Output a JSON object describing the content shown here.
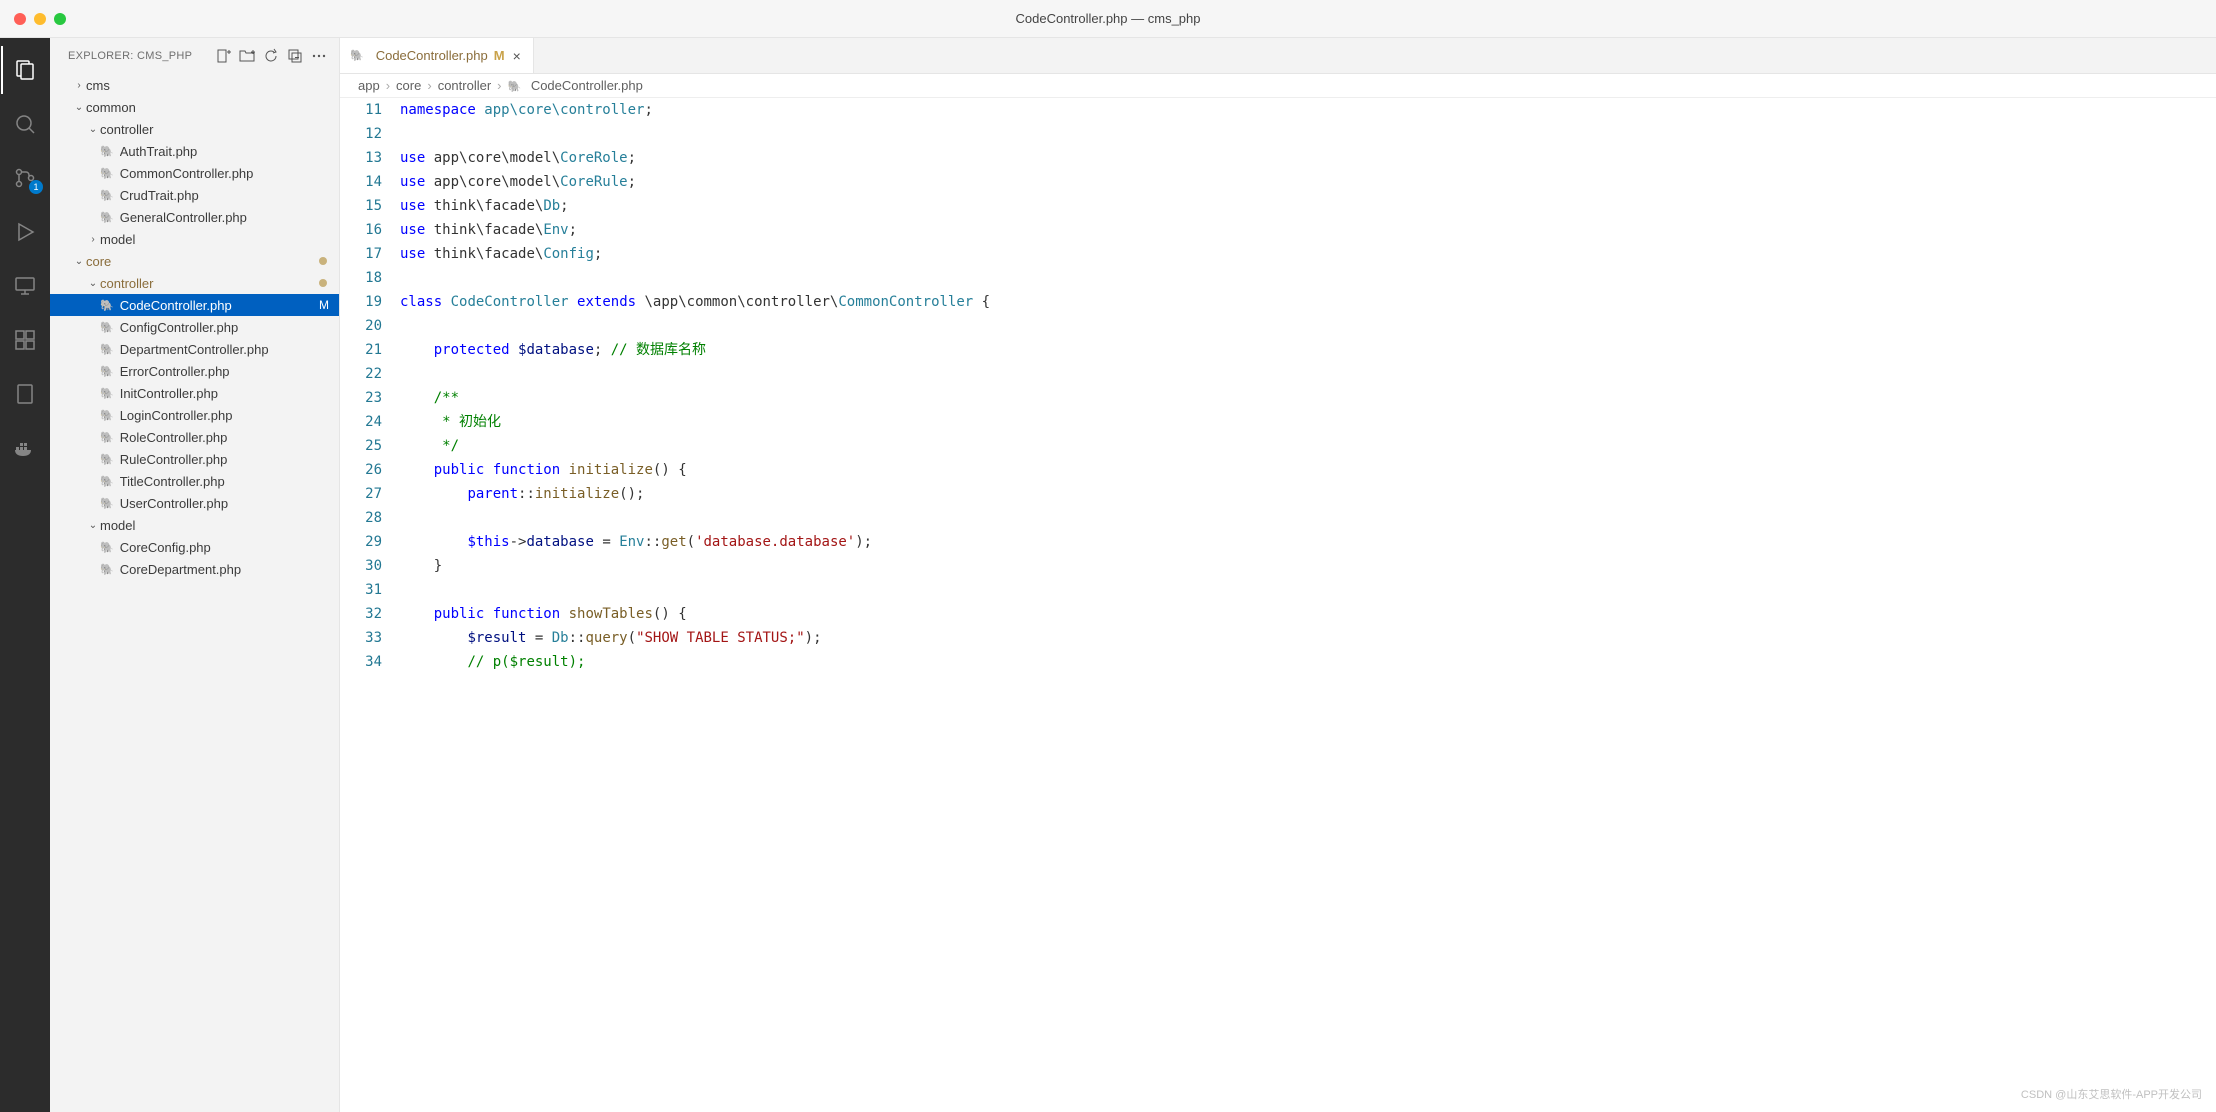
{
  "window": {
    "title": "CodeController.php — cms_php"
  },
  "activitybar": {
    "scm_badge": "1"
  },
  "sidebar": {
    "header": "EXPLORER: CMS_PHP",
    "tree": [
      {
        "depth": 1,
        "kind": "folder",
        "open": false,
        "label": "cms"
      },
      {
        "depth": 1,
        "kind": "folder",
        "open": true,
        "label": "common"
      },
      {
        "depth": 2,
        "kind": "folder",
        "open": true,
        "label": "controller"
      },
      {
        "depth": 3,
        "kind": "file",
        "icon": "php",
        "label": "AuthTrait.php"
      },
      {
        "depth": 3,
        "kind": "file",
        "icon": "php",
        "label": "CommonController.php"
      },
      {
        "depth": 3,
        "kind": "file",
        "icon": "php",
        "label": "CrudTrait.php"
      },
      {
        "depth": 3,
        "kind": "file",
        "icon": "php",
        "label": "GeneralController.php"
      },
      {
        "depth": 2,
        "kind": "folder",
        "open": false,
        "label": "model"
      },
      {
        "depth": 1,
        "kind": "folder",
        "open": true,
        "label": "core",
        "modified": true,
        "modDot": true
      },
      {
        "depth": 2,
        "kind": "folder",
        "open": true,
        "label": "controller",
        "modified": true,
        "modDot": true
      },
      {
        "depth": 3,
        "kind": "file",
        "icon": "php",
        "label": "CodeController.php",
        "selected": true,
        "modified": true,
        "mflag": "M"
      },
      {
        "depth": 3,
        "kind": "file",
        "icon": "php",
        "label": "ConfigController.php"
      },
      {
        "depth": 3,
        "kind": "file",
        "icon": "php",
        "label": "DepartmentController.php"
      },
      {
        "depth": 3,
        "kind": "file",
        "icon": "php",
        "label": "ErrorController.php"
      },
      {
        "depth": 3,
        "kind": "file",
        "icon": "php",
        "label": "InitController.php"
      },
      {
        "depth": 3,
        "kind": "file",
        "icon": "php",
        "label": "LoginController.php"
      },
      {
        "depth": 3,
        "kind": "file",
        "icon": "php",
        "label": "RoleController.php"
      },
      {
        "depth": 3,
        "kind": "file",
        "icon": "php",
        "label": "RuleController.php"
      },
      {
        "depth": 3,
        "kind": "file",
        "icon": "php",
        "label": "TitleController.php"
      },
      {
        "depth": 3,
        "kind": "file",
        "icon": "php",
        "label": "UserController.php"
      },
      {
        "depth": 2,
        "kind": "folder",
        "open": true,
        "label": "model"
      },
      {
        "depth": 3,
        "kind": "file",
        "icon": "php",
        "label": "CoreConfig.php"
      },
      {
        "depth": 3,
        "kind": "file",
        "icon": "php",
        "label": "CoreDepartment.php"
      }
    ]
  },
  "tab": {
    "icon": "php",
    "name": "CodeController.php",
    "mflag": "M"
  },
  "breadcrumbs": [
    "app",
    "core",
    "controller",
    "CodeController.php"
  ],
  "code": {
    "start": 11,
    "lines": [
      [
        {
          "t": "namespace",
          "c": "kw"
        },
        {
          "t": " "
        },
        {
          "t": "app\\core\\controller",
          "c": "ns"
        },
        {
          "t": ";"
        }
      ],
      [],
      [
        {
          "t": "use",
          "c": "kw"
        },
        {
          "t": " app\\core\\model\\"
        },
        {
          "t": "CoreRole",
          "c": "cls"
        },
        {
          "t": ";"
        }
      ],
      [
        {
          "t": "use",
          "c": "kw"
        },
        {
          "t": " app\\core\\model\\"
        },
        {
          "t": "CoreRule",
          "c": "cls"
        },
        {
          "t": ";"
        }
      ],
      [
        {
          "t": "use",
          "c": "kw"
        },
        {
          "t": " think\\facade\\"
        },
        {
          "t": "Db",
          "c": "cls"
        },
        {
          "t": ";"
        }
      ],
      [
        {
          "t": "use",
          "c": "kw"
        },
        {
          "t": " think\\facade\\"
        },
        {
          "t": "Env",
          "c": "cls"
        },
        {
          "t": ";"
        }
      ],
      [
        {
          "t": "use",
          "c": "kw"
        },
        {
          "t": " think\\facade\\"
        },
        {
          "t": "Config",
          "c": "cls"
        },
        {
          "t": ";"
        }
      ],
      [],
      [
        {
          "t": "class",
          "c": "kw"
        },
        {
          "t": " "
        },
        {
          "t": "CodeController",
          "c": "cls"
        },
        {
          "t": " "
        },
        {
          "t": "extends",
          "c": "kw"
        },
        {
          "t": " \\app\\common\\controller\\"
        },
        {
          "t": "CommonController",
          "c": "cls"
        },
        {
          "t": " {"
        }
      ],
      [],
      [
        {
          "t": "    "
        },
        {
          "t": "protected",
          "c": "kw"
        },
        {
          "t": " "
        },
        {
          "t": "$database",
          "c": "var"
        },
        {
          "t": "; "
        },
        {
          "t": "// 数据库名称",
          "c": "cm"
        }
      ],
      [],
      [
        {
          "t": "    "
        },
        {
          "t": "/**",
          "c": "cm"
        }
      ],
      [
        {
          "t": "     "
        },
        {
          "t": "* 初始化",
          "c": "cm"
        }
      ],
      [
        {
          "t": "     "
        },
        {
          "t": "*/",
          "c": "cm"
        }
      ],
      [
        {
          "t": "    "
        },
        {
          "t": "public",
          "c": "kw"
        },
        {
          "t": " "
        },
        {
          "t": "function",
          "c": "kw"
        },
        {
          "t": " "
        },
        {
          "t": "initialize",
          "c": "fn"
        },
        {
          "t": "() {"
        }
      ],
      [
        {
          "t": "        "
        },
        {
          "t": "parent",
          "c": "kw"
        },
        {
          "t": "::"
        },
        {
          "t": "initialize",
          "c": "fn"
        },
        {
          "t": "();"
        }
      ],
      [],
      [
        {
          "t": "        "
        },
        {
          "t": "$this",
          "c": "kw"
        },
        {
          "t": "->"
        },
        {
          "t": "database",
          "c": "var"
        },
        {
          "t": " = "
        },
        {
          "t": "Env",
          "c": "cls"
        },
        {
          "t": "::"
        },
        {
          "t": "get",
          "c": "fn"
        },
        {
          "t": "("
        },
        {
          "t": "'database.database'",
          "c": "str"
        },
        {
          "t": ");"
        }
      ],
      [
        {
          "t": "    }"
        }
      ],
      [],
      [
        {
          "t": "    "
        },
        {
          "t": "public",
          "c": "kw"
        },
        {
          "t": " "
        },
        {
          "t": "function",
          "c": "kw"
        },
        {
          "t": " "
        },
        {
          "t": "showTables",
          "c": "fn"
        },
        {
          "t": "() {"
        }
      ],
      [
        {
          "t": "        "
        },
        {
          "t": "$result",
          "c": "var"
        },
        {
          "t": " = "
        },
        {
          "t": "Db",
          "c": "cls"
        },
        {
          "t": "::"
        },
        {
          "t": "query",
          "c": "fn"
        },
        {
          "t": "("
        },
        {
          "t": "\"SHOW TABLE STATUS;\"",
          "c": "str"
        },
        {
          "t": ");"
        }
      ],
      [
        {
          "t": "        "
        },
        {
          "t": "// p($result);",
          "c": "cm"
        }
      ]
    ]
  },
  "watermark": "CSDN @山东艾思软件-APP开发公司"
}
